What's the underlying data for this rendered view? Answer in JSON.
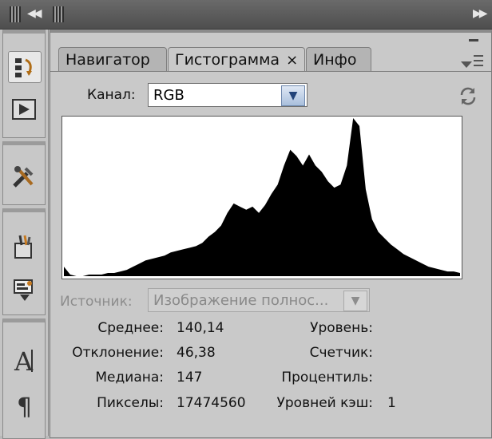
{
  "tabs": [
    {
      "label": "Навигатор"
    },
    {
      "label": "Гистограмма",
      "close": "×"
    },
    {
      "label": "Инфо"
    }
  ],
  "channel": {
    "label": "Канал:",
    "value": "RGB"
  },
  "source": {
    "label": "Источник:",
    "value": "Изображение полнос..."
  },
  "stats_left": [
    {
      "label": "Среднее:",
      "value": "140,14"
    },
    {
      "label": "Отклонение:",
      "value": "46,38"
    },
    {
      "label": "Медиана:",
      "value": "147"
    },
    {
      "label": "Пикселы:",
      "value": "17474560"
    }
  ],
  "stats_right": [
    {
      "label": "Уровень:",
      "value": ""
    },
    {
      "label": "Счетчик:",
      "value": ""
    },
    {
      "label": "Процентиль:",
      "value": ""
    },
    {
      "label": "Уровней кэш:",
      "value": "1"
    }
  ],
  "icons": {
    "refresh": "refresh-icon",
    "panel_menu": "panel-menu-icon",
    "tools": [
      "history-icon",
      "actions-play-icon",
      "tool-presets-icon",
      "brushes-icon",
      "clone-source-icon",
      "character-icon",
      "paragraph-icon"
    ]
  },
  "histogram_shape": [
    0.06,
    0.01,
    0.0,
    0.0,
    0.01,
    0.01,
    0.01,
    0.02,
    0.02,
    0.03,
    0.04,
    0.06,
    0.08,
    0.1,
    0.11,
    0.12,
    0.13,
    0.15,
    0.16,
    0.17,
    0.18,
    0.19,
    0.21,
    0.25,
    0.28,
    0.32,
    0.4,
    0.46,
    0.44,
    0.42,
    0.44,
    0.4,
    0.45,
    0.52,
    0.58,
    0.7,
    0.8,
    0.76,
    0.7,
    0.77,
    0.7,
    0.66,
    0.6,
    0.56,
    0.58,
    0.7,
    1.0,
    0.95,
    0.55,
    0.36,
    0.28,
    0.24,
    0.2,
    0.17,
    0.14,
    0.12,
    0.1,
    0.08,
    0.06,
    0.05,
    0.04,
    0.03,
    0.03,
    0.02
  ]
}
